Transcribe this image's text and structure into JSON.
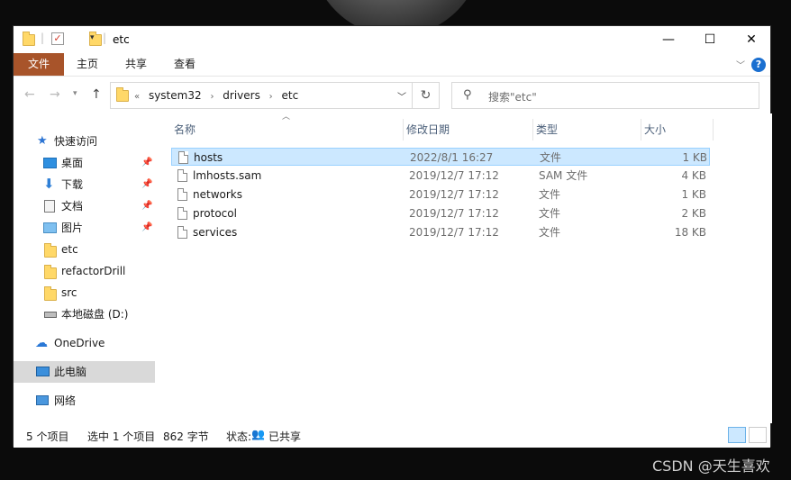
{
  "window": {
    "title": "etc",
    "minimize": "—",
    "maximize": "☐",
    "close": "✕"
  },
  "ribbon": {
    "tabs": [
      "文件",
      "主页",
      "共享",
      "查看"
    ],
    "help": "?"
  },
  "address": {
    "crumbs": [
      "«",
      "system32",
      "drivers",
      "etc"
    ],
    "search_placeholder": "搜索\"etc\""
  },
  "sidebar": {
    "items": [
      {
        "label": "快速访问",
        "icon": "star-icon",
        "pinned": false
      },
      {
        "label": "桌面",
        "icon": "desktop-icon",
        "pinned": true
      },
      {
        "label": "下载",
        "icon": "download-icon",
        "pinned": true
      },
      {
        "label": "文档",
        "icon": "document-icon",
        "pinned": true
      },
      {
        "label": "图片",
        "icon": "pictures-icon",
        "pinned": true
      },
      {
        "label": "etc",
        "icon": "folder-icon",
        "pinned": false
      },
      {
        "label": "refactorDrill",
        "icon": "folder-icon",
        "pinned": false
      },
      {
        "label": "src",
        "icon": "folder-icon",
        "pinned": false
      },
      {
        "label": "本地磁盘 (D:)",
        "icon": "drive-icon",
        "pinned": false
      },
      {
        "label": "OneDrive",
        "icon": "cloud-icon",
        "pinned": false
      },
      {
        "label": "此电脑",
        "icon": "computer-icon",
        "pinned": false,
        "selected": true
      },
      {
        "label": "网络",
        "icon": "network-icon",
        "pinned": false
      }
    ]
  },
  "list": {
    "columns": [
      "名称",
      "修改日期",
      "类型",
      "大小"
    ],
    "rows": [
      {
        "name": "hosts",
        "date": "2022/8/1 16:27",
        "type": "文件",
        "size": "1 KB",
        "selected": true
      },
      {
        "name": "lmhosts.sam",
        "date": "2019/12/7 17:12",
        "type": "SAM 文件",
        "size": "4 KB"
      },
      {
        "name": "networks",
        "date": "2019/12/7 17:12",
        "type": "文件",
        "size": "1 KB"
      },
      {
        "name": "protocol",
        "date": "2019/12/7 17:12",
        "type": "文件",
        "size": "2 KB"
      },
      {
        "name": "services",
        "date": "2019/12/7 17:12",
        "type": "文件",
        "size": "18 KB"
      }
    ]
  },
  "status": {
    "count": "5 个项目",
    "selection": "选中 1 个项目",
    "size": "862 字节",
    "state_label": "状态:",
    "state_value": "已共享"
  },
  "watermark": "CSDN @天生喜欢",
  "colors": {
    "file_tab": "#a8542a",
    "selection": "#cce8ff",
    "header_text": "#4c607a",
    "accent": "#2b74d3"
  }
}
